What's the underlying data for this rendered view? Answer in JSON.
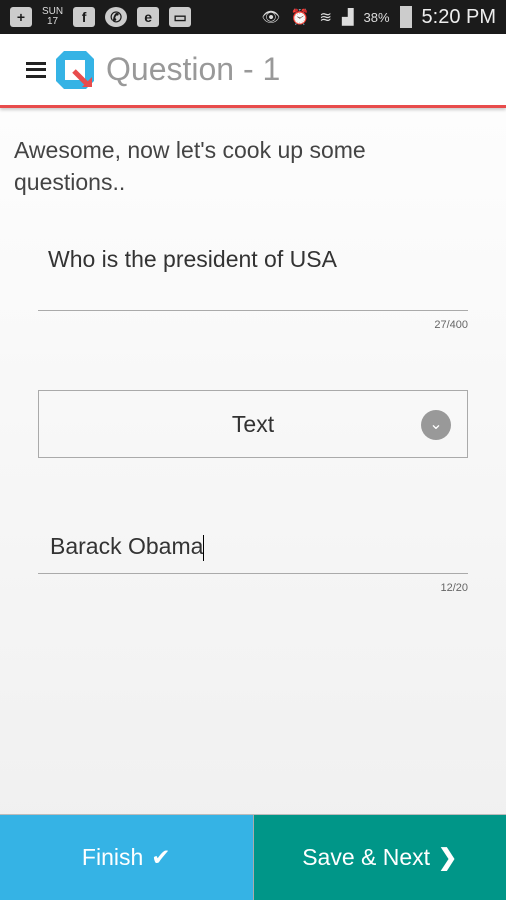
{
  "status_bar": {
    "day": "SUN",
    "date": "17",
    "battery": "38%",
    "time": "5:20 PM",
    "icons": [
      "add-icon",
      "facebook-icon",
      "whatsapp-icon",
      "evernote-icon",
      "image-icon",
      "eye-icon",
      "alarm-icon",
      "wifi-icon",
      "signal-icon",
      "battery-icon"
    ]
  },
  "header": {
    "title": "Question - 1"
  },
  "main": {
    "intro": "Awesome, now let's cook up some questions..",
    "question": {
      "value": "Who is the president of USA",
      "counter": "27/400"
    },
    "type_select": {
      "value": "Text"
    },
    "answer": {
      "value": "Barack Obama",
      "counter": "12/20"
    }
  },
  "footer": {
    "finish_label": "Finish",
    "next_label": "Save & Next"
  },
  "colors": {
    "accent": "#e84c4c",
    "finish": "#35b3e5",
    "next": "#009688"
  }
}
